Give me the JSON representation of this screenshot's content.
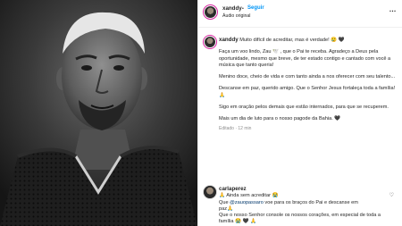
{
  "post": {
    "username": "xanddy",
    "separator": "•",
    "follow_label": "Seguir",
    "audio_label": "Áudio original",
    "more_label": "…"
  },
  "caption": {
    "username": "xanddy",
    "first_line": "Muito difícil de acreditar, mas é verdade! 😢 🖤",
    "p1": "Faça um voo lindo, Zau 🕊️ , que o Pai te receba. Agradeço a Deus pela oportunidade, mesmo que breve, de ter estado contigo e cantado com você a música que tanto queria!",
    "p2": "Menino doce, cheio de vida e com tanto ainda a nos oferecer com seu talento...",
    "p3": "Descanse em paz, querido amigo. Que o Senhor Jesus fortaleça toda a família! 🙏",
    "p4": "Sigo em oração pelos demais que estão internados, para que se recuperem.",
    "p5": "Mais um dia de luto para o nosso pagode da Bahia. 🖤",
    "meta": "Editado · 12 min"
  },
  "comment": {
    "username": "carlaperez",
    "line1": "🙏 Ainda sem acreditar 😭",
    "line2_pre": "Que ",
    "mention": "@zauopassaro",
    "line2_post": " voe para os braços do Pai e descanse em",
    "line3": "paz🙏",
    "line4": "Que o nosso Senhor console os nossos corações, em especial de toda a família 😭 🖤 🙏"
  }
}
